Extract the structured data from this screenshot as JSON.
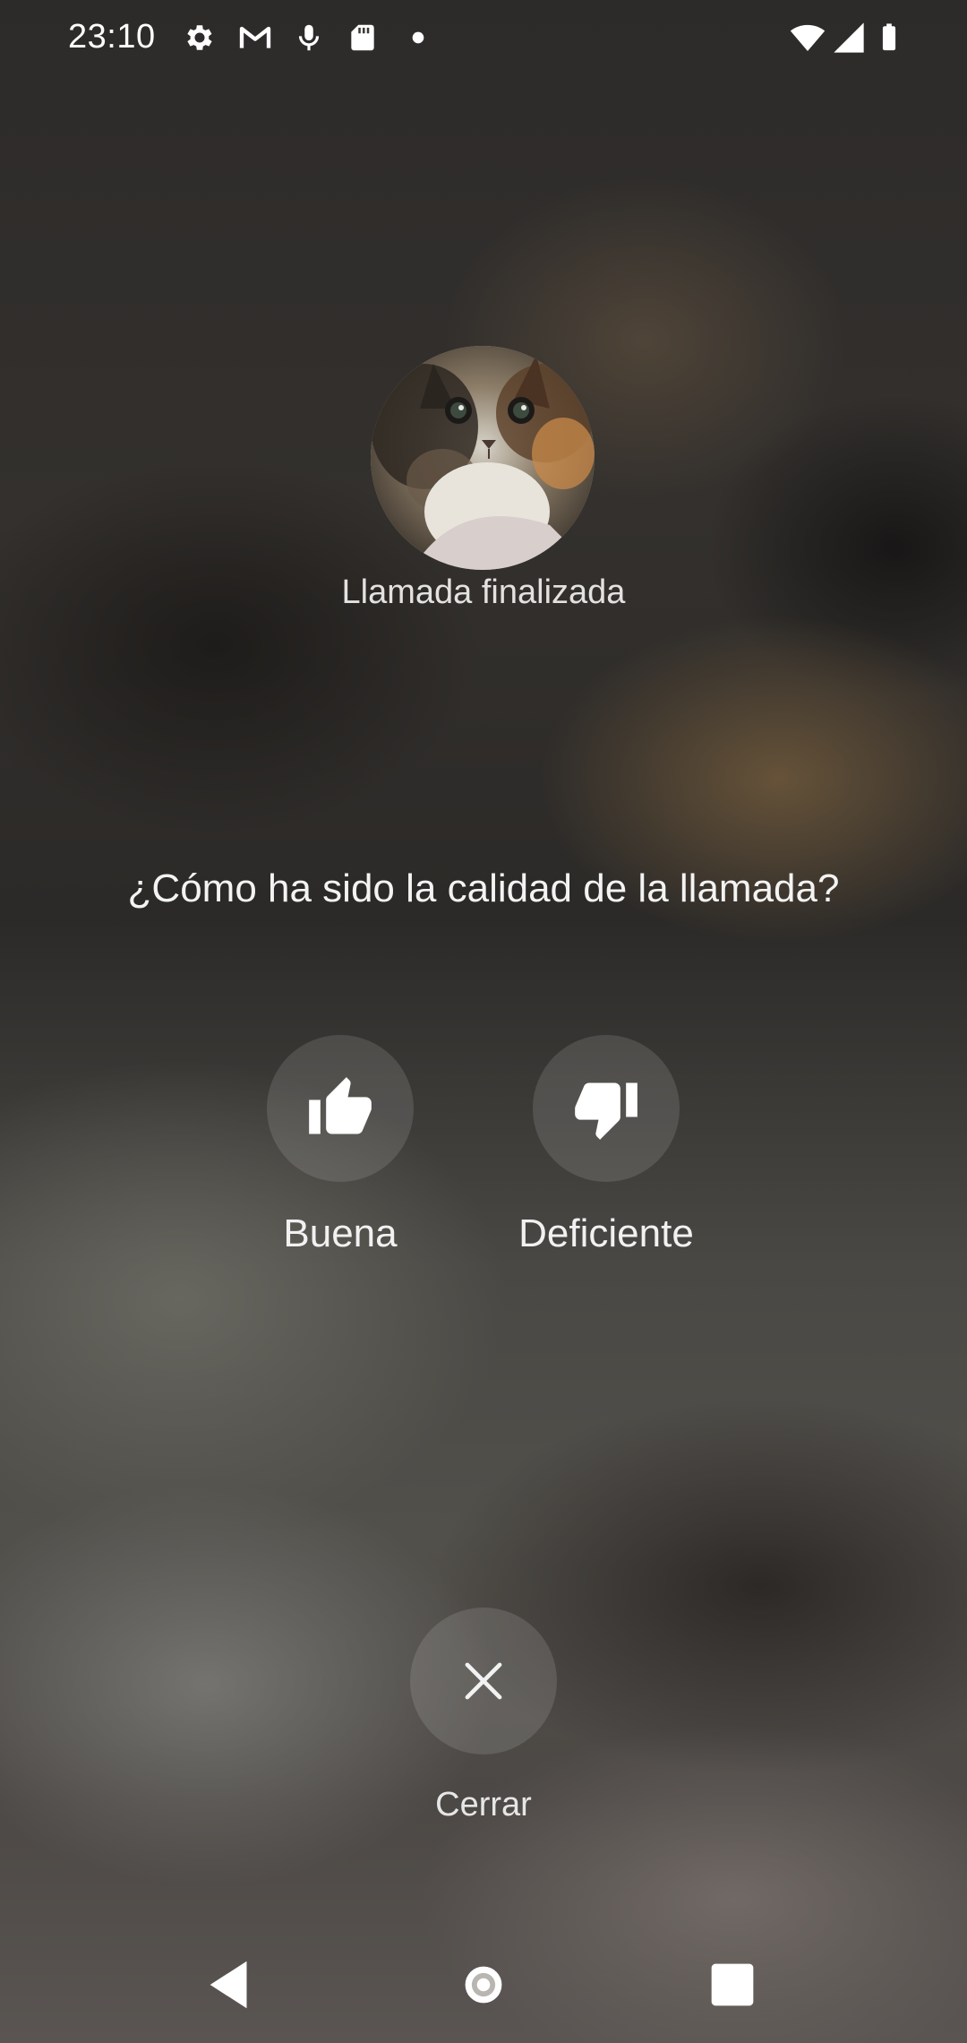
{
  "status_bar": {
    "time": "23:10",
    "icons": [
      "settings-icon",
      "gmail-icon",
      "mic-icon",
      "sd-card-icon",
      "dot-icon",
      "wifi-icon",
      "signal-icon",
      "battery-icon"
    ]
  },
  "contact": {
    "avatar": "cat-photo",
    "call_status": "Llamada finalizada"
  },
  "feedback": {
    "question": "¿Cómo ha sido la calidad de la llamada?",
    "good_label": "Buena",
    "bad_label": "Deficiente"
  },
  "close": {
    "label": "Cerrar"
  },
  "nav_bar": {
    "icons": [
      "back-icon",
      "home-icon",
      "recents-icon"
    ]
  }
}
